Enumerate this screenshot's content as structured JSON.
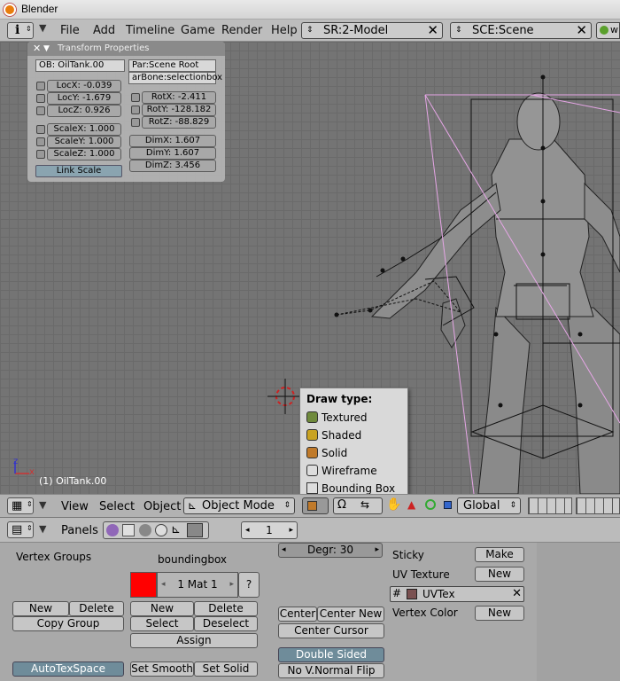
{
  "window": {
    "title": "Blender"
  },
  "menu": {
    "items": [
      "File",
      "Add",
      "Timeline",
      "Game",
      "Render",
      "Help"
    ],
    "screen": "SR:2-Model",
    "scene": "SCE:Scene",
    "extra": "w"
  },
  "transform": {
    "title": "Transform Properties",
    "ob": "OB: OilTank.00",
    "par": "Par:Scene Root",
    "bone": "arBone:selectionbox",
    "loc": [
      "LocX: -0.039",
      "LocY: -1.679",
      "LocZ: 0.926"
    ],
    "rot": [
      "RotX: -2.411",
      "RotY: -128.182",
      "RotZ: -88.829"
    ],
    "scale": [
      "ScaleX: 1.000",
      "ScaleY: 1.000",
      "ScaleZ: 1.000"
    ],
    "dim": [
      "DimX: 1.607",
      "DimY: 1.607",
      "DimZ: 3.456"
    ],
    "link_scale": "Link Scale"
  },
  "viewport": {
    "object_label": "(1) OilTank.00"
  },
  "drawtype": {
    "title": "Draw type:",
    "items": [
      {
        "label": "Textured",
        "color": "#6f8a3c"
      },
      {
        "label": "Shaded",
        "color": "#c9a322"
      },
      {
        "label": "Solid",
        "color": "#c07a2a"
      },
      {
        "label": "Wireframe",
        "color": "#dddddd"
      },
      {
        "label": "Bounding Box",
        "color": "#dddddd"
      }
    ]
  },
  "view_header": {
    "view": "View",
    "select": "Select",
    "object": "Object",
    "mode": "Object Mode",
    "orientation": "Global"
  },
  "buttons_header": {
    "panels": "Panels",
    "frame": "1"
  },
  "editing": {
    "vertex_groups": "Vertex Groups",
    "new": "New",
    "delete": "Delete",
    "copy_group": "Copy Group",
    "mesh_name": "boundingbox",
    "mat": "1 Mat 1",
    "question": "?",
    "mat_new": "New",
    "mat_delete": "Delete",
    "select": "Select",
    "deselect": "Deselect",
    "assign": "Assign",
    "autotexspace": "AutoTexSpace",
    "set_smooth": "Set Smooth",
    "set_solid": "Set Solid",
    "degr": "Degr: 30",
    "center": "Center",
    "center_new": "Center New",
    "center_cursor": "Center Cursor",
    "double_sided": "Double Sided",
    "no_vnormal_flip": "No V.Normal Flip",
    "sticky": "Sticky",
    "make": "Make",
    "uv_texture": "UV Texture",
    "uv_new": "New",
    "uvtex": "UVTex",
    "vertex_color": "Vertex Color",
    "vc_new": "New",
    "mat_color": "#ff0000"
  }
}
